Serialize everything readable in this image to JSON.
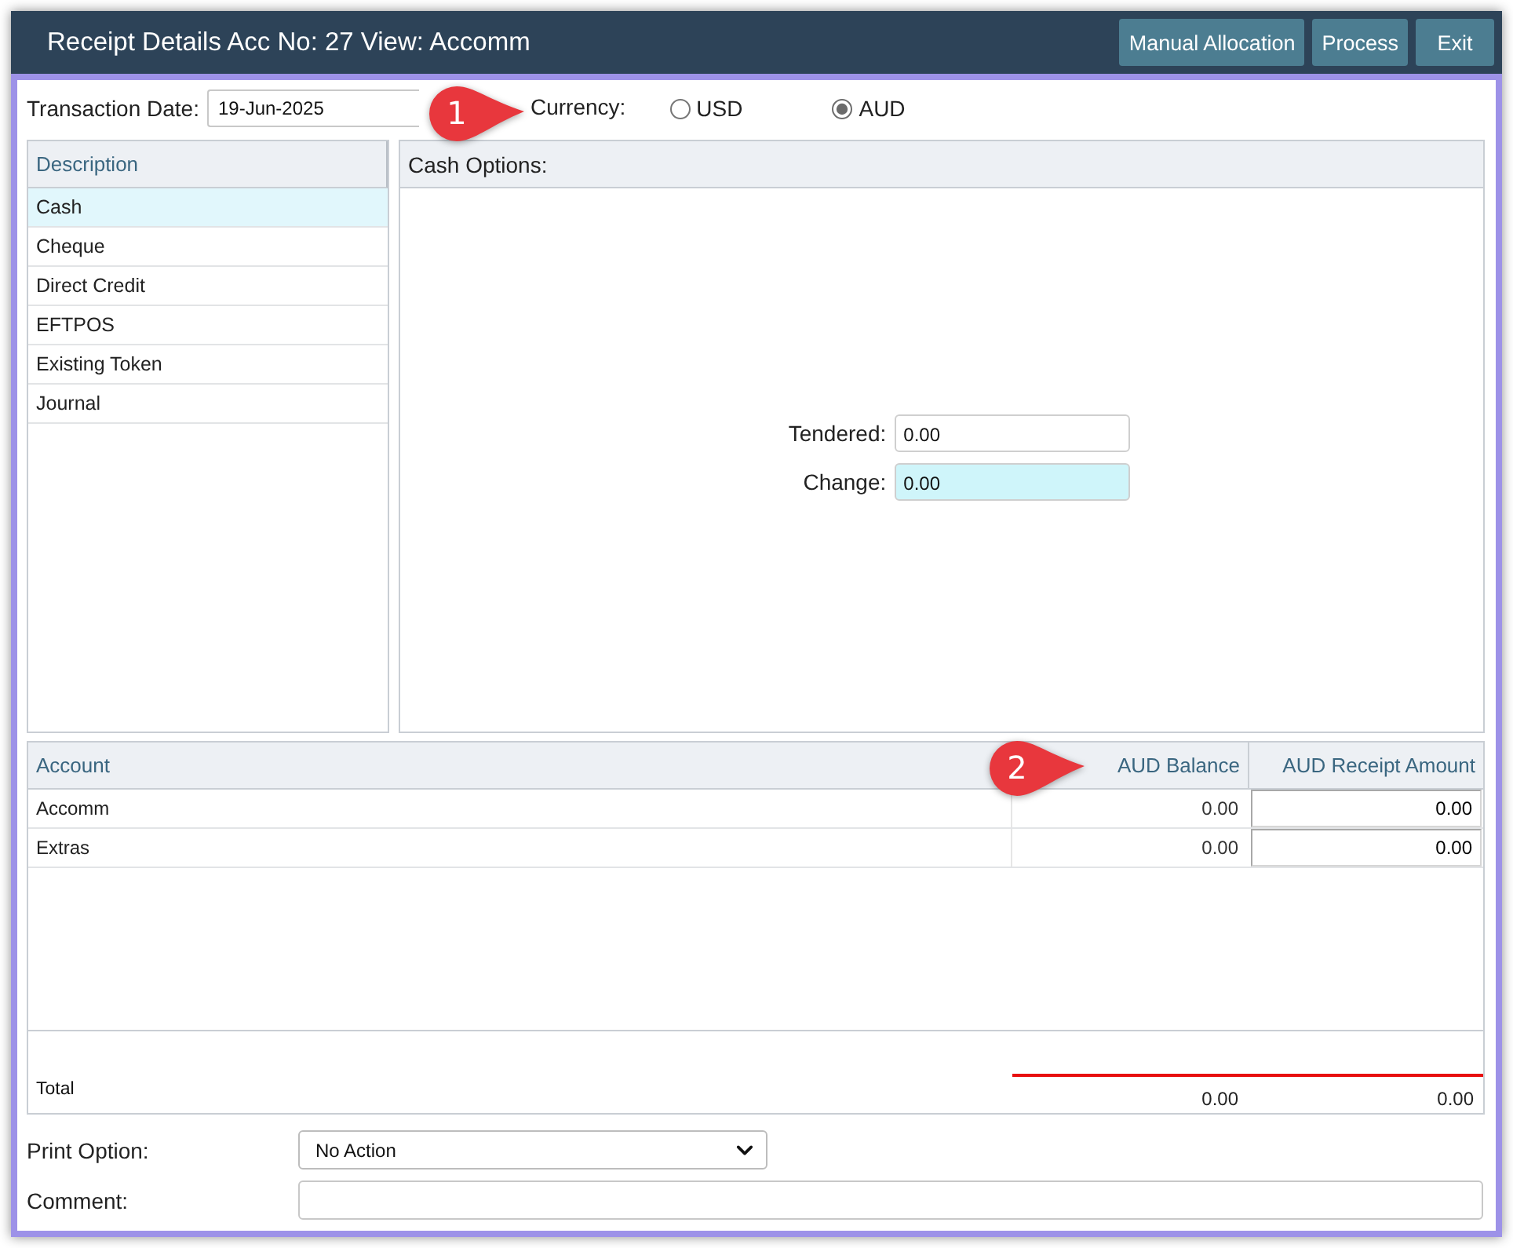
{
  "window": {
    "title": "Receipt Details Acc No: 27 View: Accomm",
    "buttons": [
      {
        "label": "Manual Allocation"
      },
      {
        "label": "Process"
      },
      {
        "label": "Exit"
      }
    ]
  },
  "transaction_date": {
    "label": "Transaction Date:",
    "value": "19-Jun-2025"
  },
  "currency": {
    "label": "Currency:",
    "callout": "1",
    "options": [
      {
        "label": "USD",
        "selected": false
      },
      {
        "label": "AUD",
        "selected": true
      }
    ]
  },
  "payment_methods": {
    "heading": "Description",
    "items": [
      {
        "label": "Cash",
        "selected": true
      },
      {
        "label": "Cheque",
        "selected": false
      },
      {
        "label": "Direct Credit",
        "selected": false
      },
      {
        "label": "EFTPOS",
        "selected": false
      },
      {
        "label": "Existing Token",
        "selected": false
      },
      {
        "label": "Journal",
        "selected": false
      }
    ]
  },
  "cash_options": {
    "title": "Cash Options:",
    "fields": [
      {
        "label": "Tendered:",
        "value": "0.00",
        "readonly": false
      },
      {
        "label": "Change:",
        "value": "0.00",
        "readonly": true
      }
    ]
  },
  "accounts_table": {
    "columns": [
      {
        "label": "Account"
      },
      {
        "label": "AUD Balance",
        "callout": "2"
      },
      {
        "label": "AUD Receipt Amount"
      }
    ],
    "rows": [
      {
        "account": "Accomm",
        "balance": "0.00",
        "receipt_amount": "0.00"
      },
      {
        "account": "Extras",
        "balance": "0.00",
        "receipt_amount": "0.00"
      }
    ],
    "total": {
      "label": "Total",
      "balance": "0.00",
      "receipt_amount": "0.00"
    }
  },
  "print_option": {
    "label": "Print Option:",
    "value": "No Action"
  },
  "comment": {
    "label": "Comment:"
  }
}
